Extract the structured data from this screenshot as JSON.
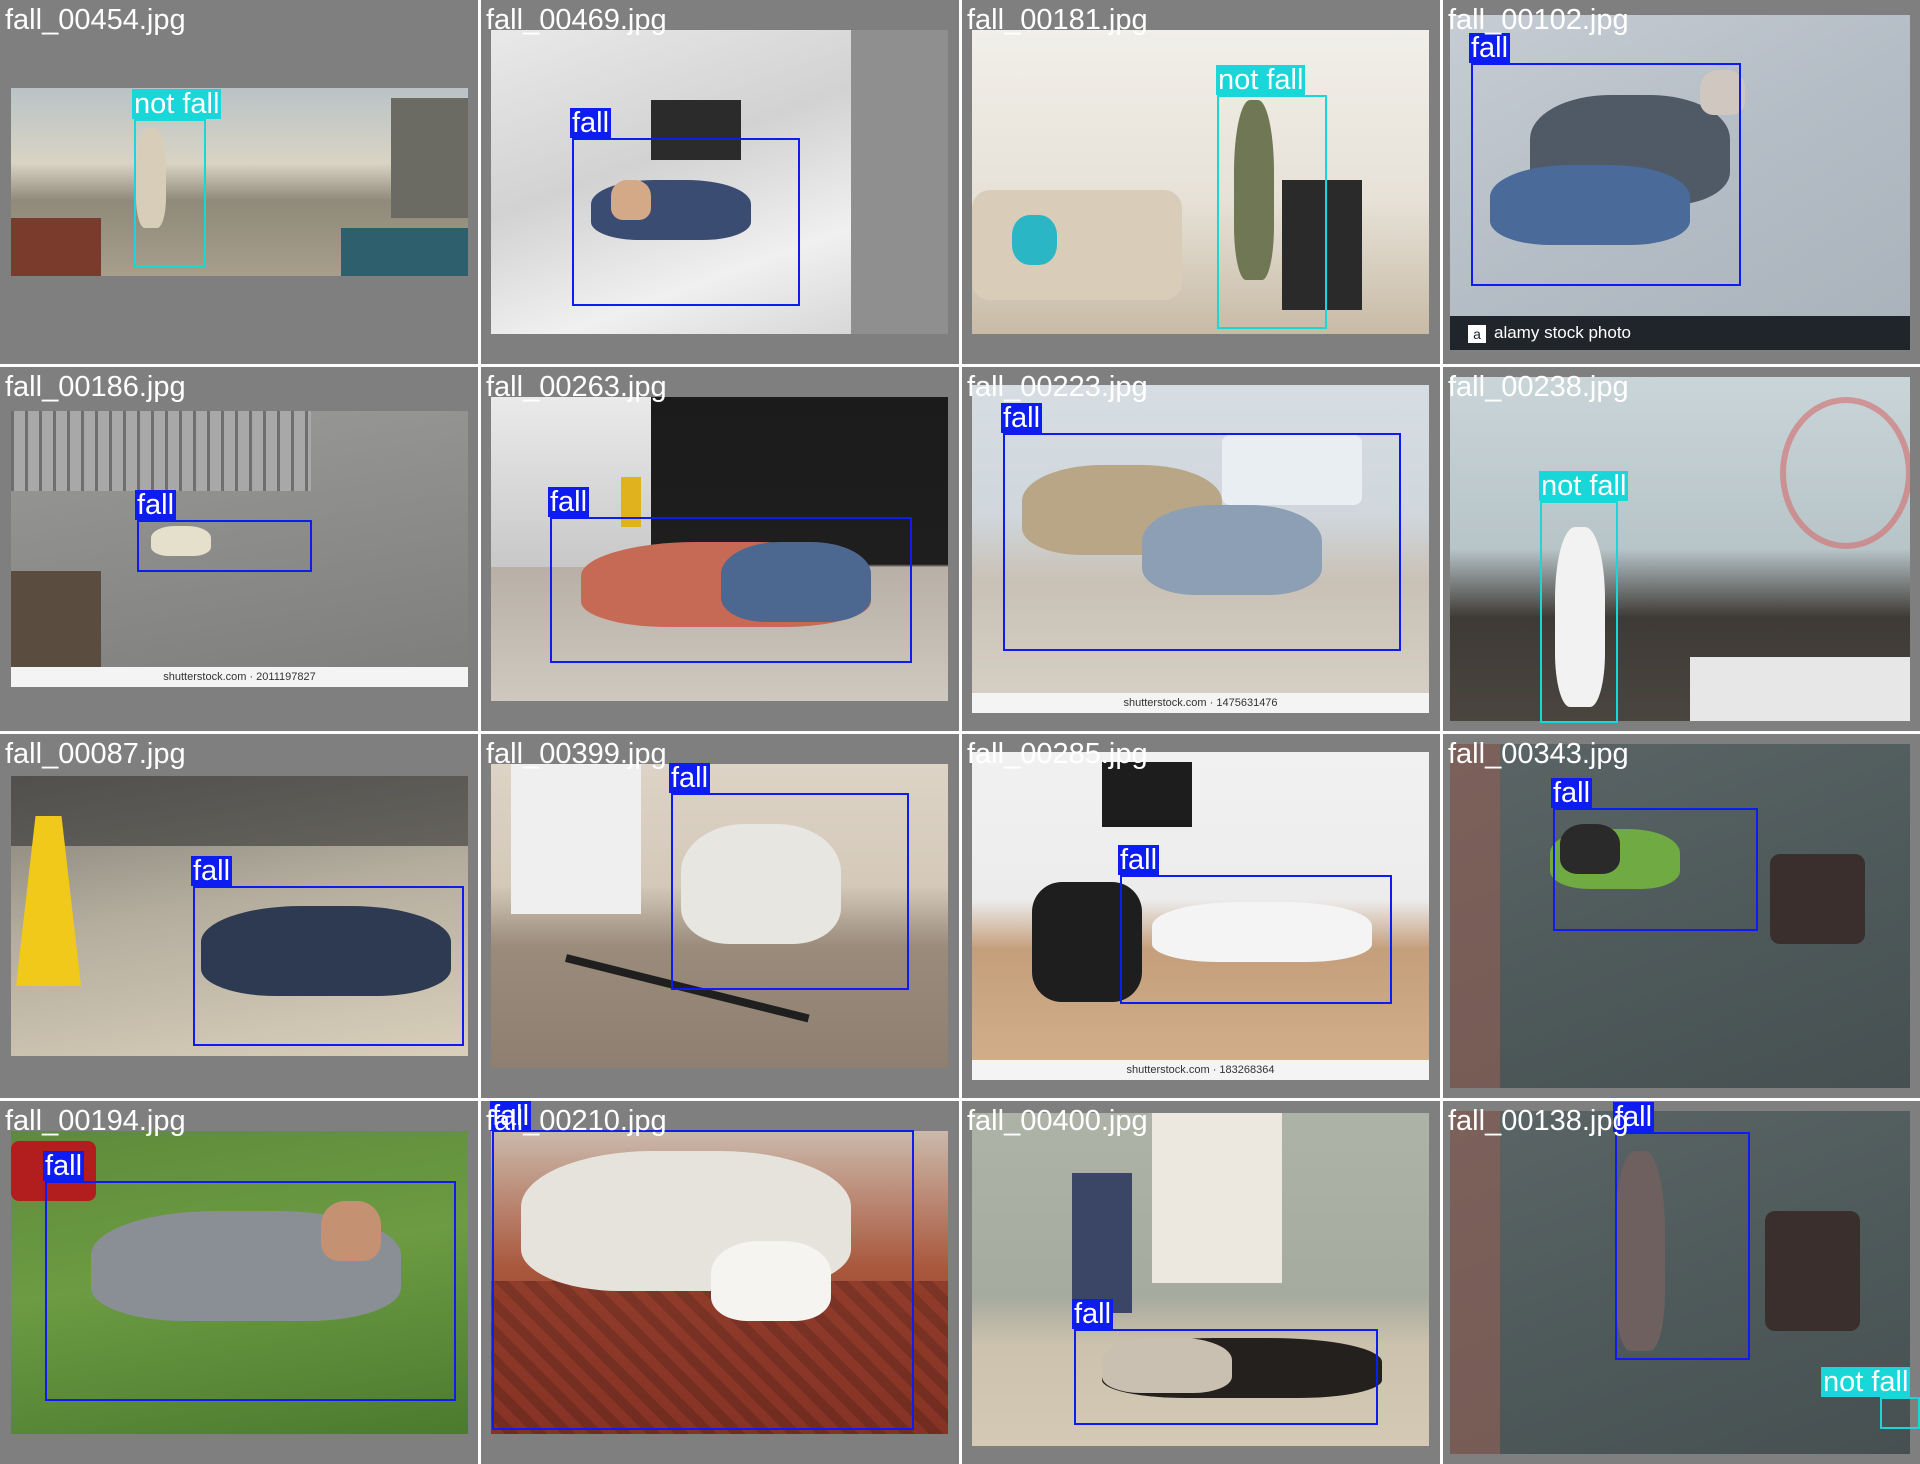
{
  "colors": {
    "fall": "#0d1cf0",
    "not_fall": "#19d6d8",
    "tile_bg": "#7f7f7f"
  },
  "tiles": [
    {
      "filename": "fall_00454.jpg",
      "labels": [
        "not fall"
      ]
    },
    {
      "filename": "fall_00469.jpg",
      "labels": [
        "fall"
      ]
    },
    {
      "filename": "fall_00181.jpg",
      "labels": [
        "not fall"
      ]
    },
    {
      "filename": "fall_00102.jpg",
      "labels": [
        "fall"
      ],
      "watermark": "alamy stock photo"
    },
    {
      "filename": "fall_00186.jpg",
      "labels": [
        "fall"
      ],
      "watermark": "shutterstock.com · 2011197827"
    },
    {
      "filename": "fall_00263.jpg",
      "labels": [
        "fall"
      ]
    },
    {
      "filename": "fall_00223.jpg",
      "labels": [
        "fall"
      ],
      "watermark": "shutterstock.com · 1475631476"
    },
    {
      "filename": "fall_00238.jpg",
      "labels": [
        "not fall"
      ]
    },
    {
      "filename": "fall_00087.jpg",
      "labels": [
        "fall"
      ]
    },
    {
      "filename": "fall_00399.jpg",
      "labels": [
        "fall"
      ]
    },
    {
      "filename": "fall_00285.jpg",
      "labels": [
        "fall"
      ],
      "watermark": "shutterstock.com · 183268364"
    },
    {
      "filename": "fall_00343.jpg",
      "labels": [
        "fall"
      ]
    },
    {
      "filename": "fall_00194.jpg",
      "labels": [
        "fall"
      ]
    },
    {
      "filename": "fall_00210.jpg",
      "labels": [
        "fall"
      ]
    },
    {
      "filename": "fall_00400.jpg",
      "labels": [
        "fall"
      ]
    },
    {
      "filename": "fall_00138.jpg",
      "labels": [
        "fall",
        "not fall"
      ]
    }
  ]
}
